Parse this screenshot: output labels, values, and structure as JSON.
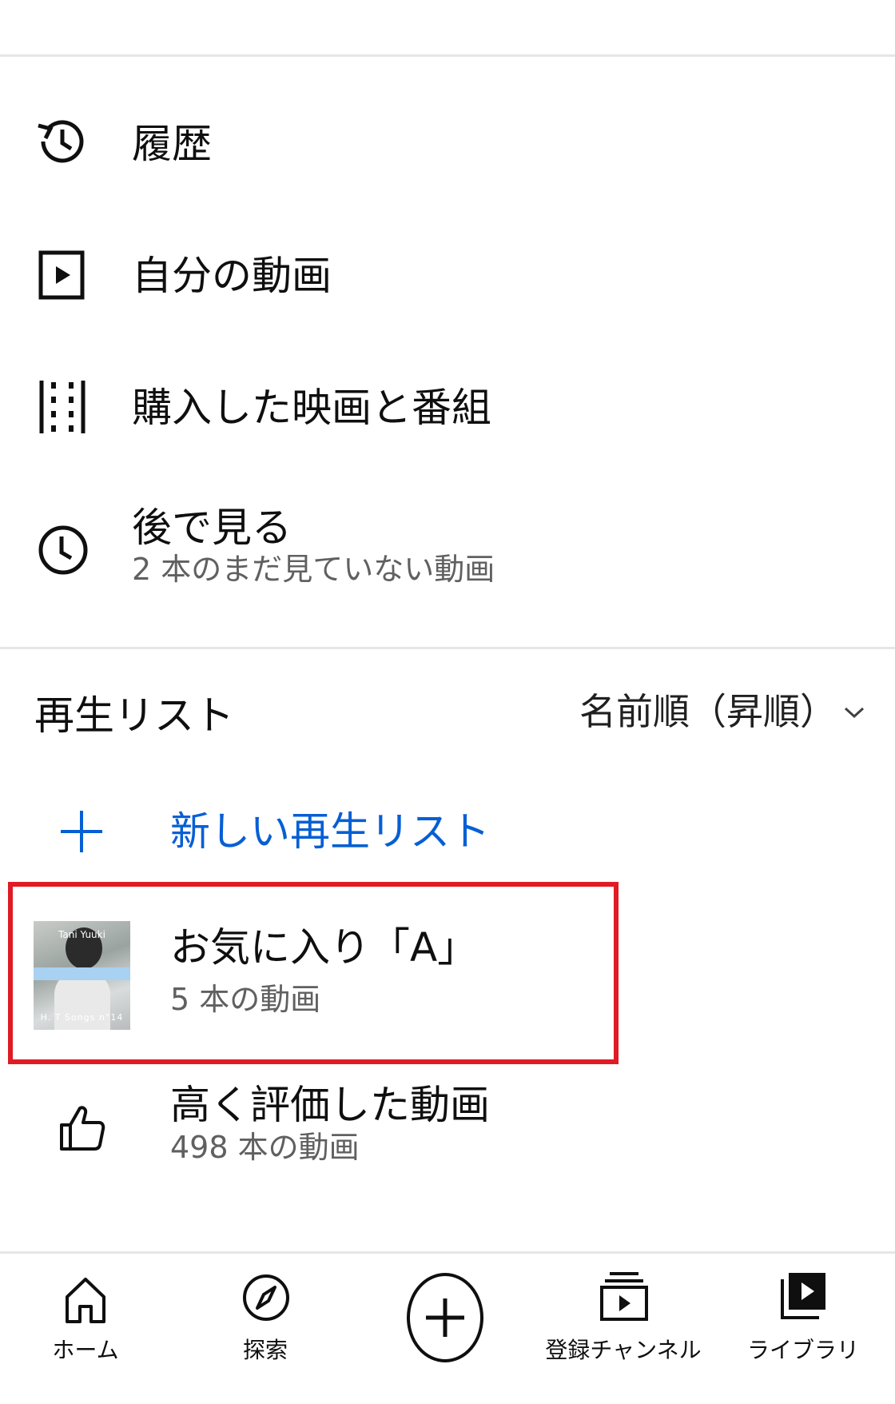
{
  "menu": {
    "history": {
      "label": "履歴",
      "icon": "history-icon"
    },
    "my_videos": {
      "label": "自分の動画",
      "icon": "play-square-icon"
    },
    "purchases": {
      "label": "購入した映画と番組",
      "icon": "film-strip-icon"
    },
    "watch_later": {
      "label": "後で見る",
      "sub": "2 本のまだ見ていない動画",
      "icon": "clock-icon"
    }
  },
  "playlists": {
    "title": "再生リスト",
    "sort_label": "名前順（昇順）",
    "sort_icon": "chevron-down-icon",
    "new_label": "新しい再生リスト",
    "accent_color": "#065fd4",
    "highlight_color": "#e01b24",
    "items": [
      {
        "title": "お気に入り「A」",
        "sub": "5 本の動画",
        "thumb_top": "Tani Yuuki",
        "thumb_caption": "H. T Songs n°14"
      },
      {
        "title": "高く評価した動画",
        "sub": "498 本の動画",
        "icon": "thumbs-up-icon"
      }
    ]
  },
  "nav": {
    "home": "ホーム",
    "explore": "探索",
    "create": "create-icon",
    "subscriptions": "登録チャンネル",
    "library": "ライブラリ"
  }
}
